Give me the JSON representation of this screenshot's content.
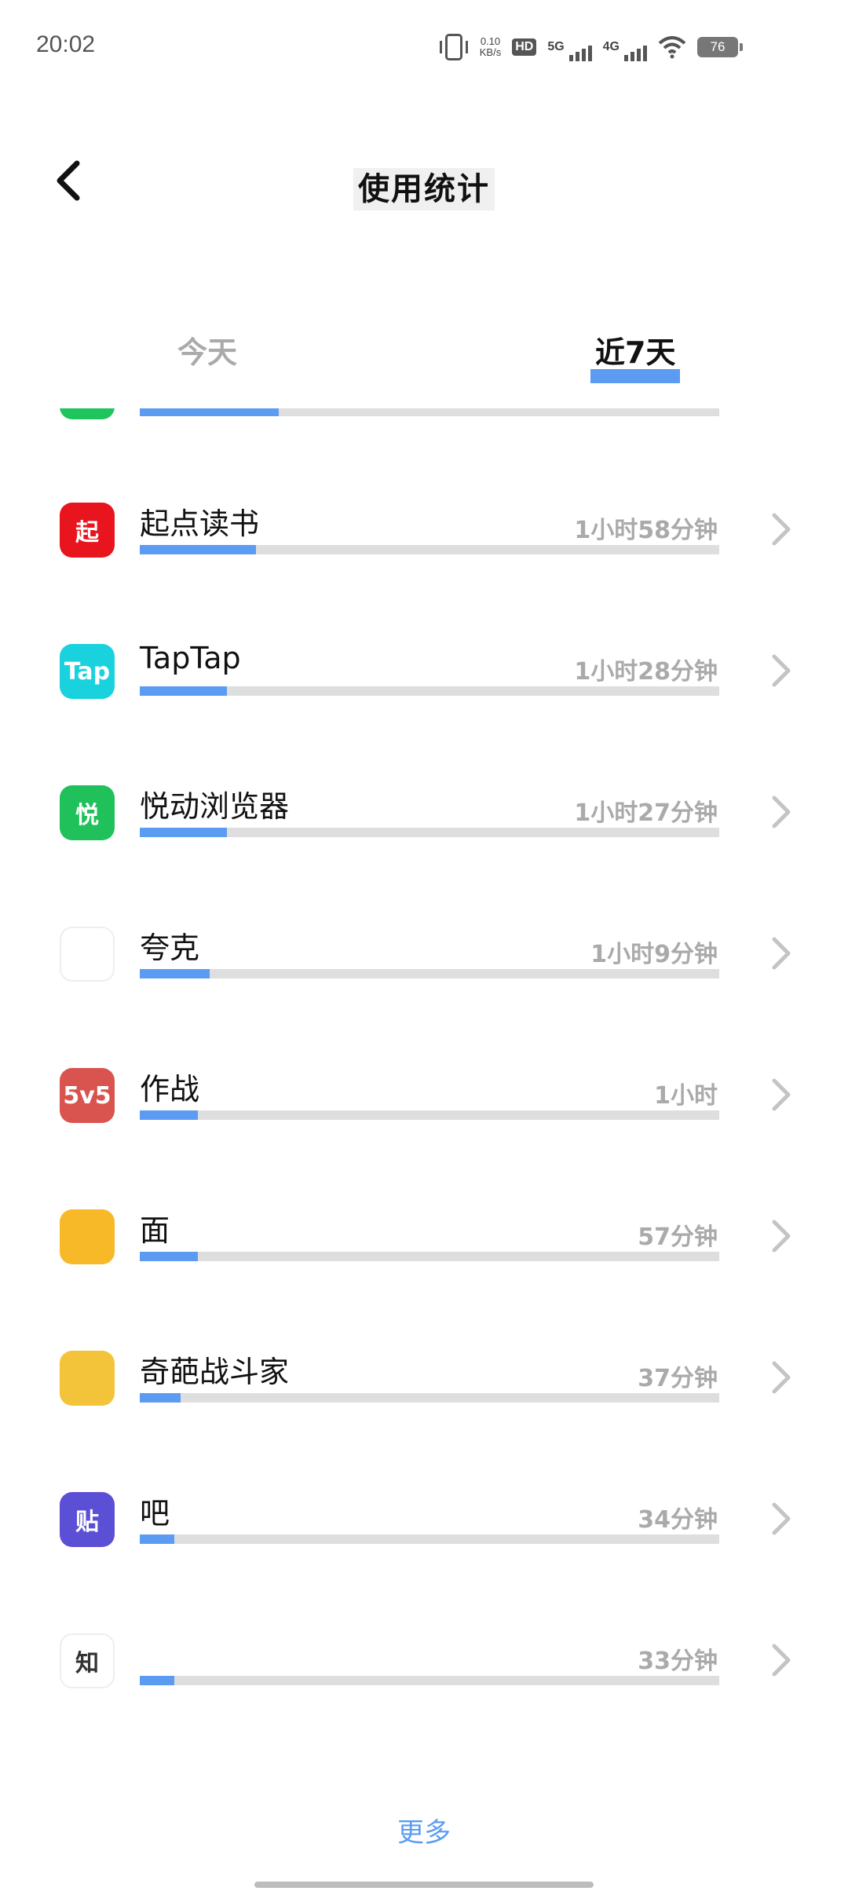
{
  "status_bar": {
    "time": "20:02",
    "net_speed_value": "0.10",
    "net_speed_unit": "KB/s",
    "hd_label": "HD",
    "sim1_label": "5G",
    "sim2_label": "4G",
    "battery": "76",
    "icons": [
      "vibrate-icon",
      "hd-icon",
      "signal-icon",
      "signal-icon",
      "wifi-icon",
      "battery-icon"
    ]
  },
  "header": {
    "back_icon": "chevron-left-icon",
    "title": "使用统计"
  },
  "tabs": [
    {
      "label": "今天",
      "active": false
    },
    {
      "label": "近7天",
      "active": true
    }
  ],
  "colors": {
    "accent": "#5b9cf2",
    "track": "#dedede",
    "muted_text": "#aaaaaa"
  },
  "apps": [
    {
      "name": "",
      "time": "",
      "usage_fraction": 0.24,
      "icon_color": "#1fc45c",
      "icon_text": ""
    },
    {
      "name": "起点读书",
      "time": "1小时58分钟",
      "usage_fraction": 0.2,
      "icon_color": "#e8141e",
      "icon_text": "起"
    },
    {
      "name": "TapTap",
      "time": "1小时28分钟",
      "usage_fraction": 0.15,
      "icon_color": "#19d2de",
      "icon_text": "Tap"
    },
    {
      "name": "悦动浏览器",
      "time": "1小时27分钟",
      "usage_fraction": 0.15,
      "icon_color": "#20c05a",
      "icon_text": "悦"
    },
    {
      "name": "夸克",
      "time": "1小时9分钟",
      "usage_fraction": 0.12,
      "icon_color": "#ffffff",
      "icon_text": ""
    },
    {
      "name": "作战",
      "time": "1小时",
      "usage_fraction": 0.1,
      "icon_color": "#d9534f",
      "icon_text": "5v5"
    },
    {
      "name": "面",
      "time": "57分钟",
      "usage_fraction": 0.1,
      "icon_color": "#f7b928",
      "icon_text": ""
    },
    {
      "name": "奇葩战斗家",
      "time": "37分钟",
      "usage_fraction": 0.07,
      "icon_color": "#f3c33a",
      "icon_text": ""
    },
    {
      "name": "吧",
      "time": "34分钟",
      "usage_fraction": 0.06,
      "icon_color": "#5b4fd6",
      "icon_text": "贴"
    },
    {
      "name": "",
      "time": "33分钟",
      "usage_fraction": 0.06,
      "icon_color": "#ffffff",
      "icon_text": "知"
    }
  ],
  "more_label": "更多"
}
